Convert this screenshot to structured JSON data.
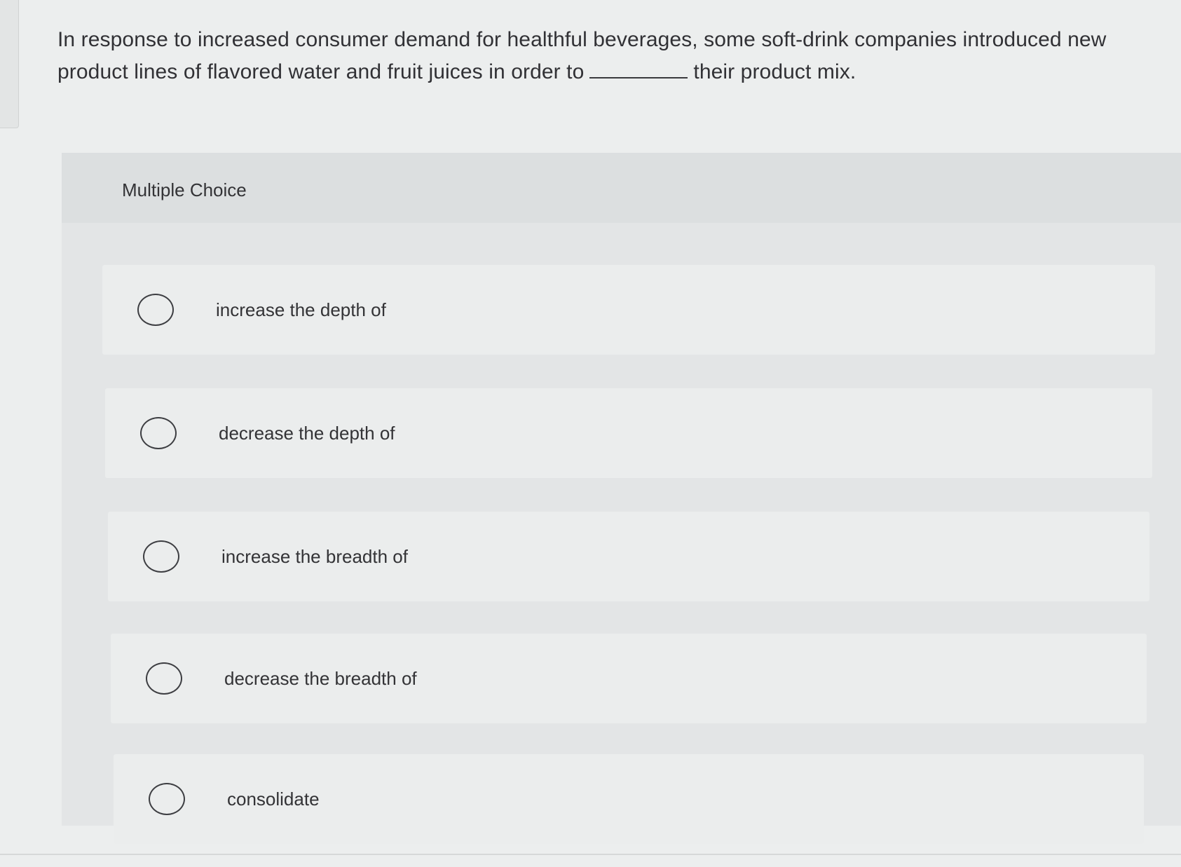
{
  "question": {
    "text_before": "In response to increased consumer demand for healthful beverages, some soft-drink companies introduced new product lines of flavored water and fruit juices in order to",
    "text_after": "their product mix."
  },
  "panel": {
    "title": "Multiple Choice"
  },
  "options": [
    {
      "label": "increase the depth of",
      "selected": false
    },
    {
      "label": "decrease the depth of",
      "selected": false
    },
    {
      "label": "increase the breadth of",
      "selected": false
    },
    {
      "label": "decrease the breadth of",
      "selected": false
    },
    {
      "label": "consolidate",
      "selected": false
    }
  ]
}
